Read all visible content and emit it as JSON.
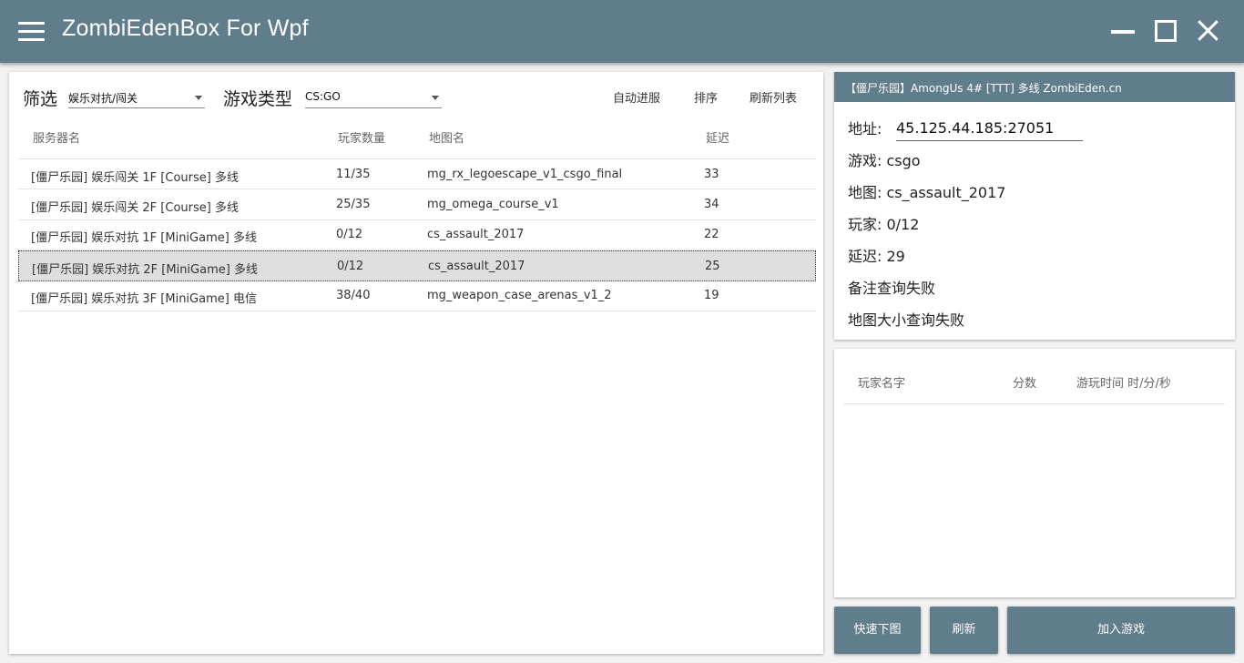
{
  "app": {
    "title": "ZombiEdenBox For Wpf"
  },
  "filter": {
    "label": "筛选",
    "value": "娱乐对抗/闯关",
    "game_type_label": "游戏类型",
    "game_type_value": "CS:GO"
  },
  "toolbar": {
    "auto_join_label": "自动进服",
    "sort_label": "排序",
    "refresh_list_label": "刷新列表"
  },
  "server_table": {
    "columns": [
      "服务器名",
      "玩家数量",
      "地图名",
      "延迟"
    ],
    "rows": [
      {
        "name": "[僵尸乐园] 娱乐闯关 1F [Course] 多线",
        "players": "11/35",
        "map": "mg_rx_legoescape_v1_csgo_final",
        "ping": "33"
      },
      {
        "name": "[僵尸乐园] 娱乐闯关 2F [Course] 多线",
        "players": "25/35",
        "map": "mg_omega_course_v1",
        "ping": "34"
      },
      {
        "name": "[僵尸乐园] 娱乐对抗 1F [MiniGame] 多线",
        "players": "0/12",
        "map": "cs_assault_2017",
        "ping": "22"
      },
      {
        "name": "[僵尸乐园] 娱乐对抗 2F [MiniGame] 多线",
        "players": "0/12",
        "map": "cs_assault_2017",
        "ping": "25"
      },
      {
        "name": "[僵尸乐园] 娱乐对抗 3F [MiniGame] 电信",
        "players": "38/40",
        "map": "mg_weapon_case_arenas_v1_2",
        "ping": "19"
      }
    ],
    "selected_index": 3
  },
  "server_info": {
    "header": "【僵尸乐园】AmongUs 4# [TTT] 多线 ZombiEden.cn",
    "address_label": "地址:",
    "address_value": "45.125.44.185:27051",
    "game": "游戏: csgo",
    "map": "地图: cs_assault_2017",
    "players": "玩家: 0/12",
    "ping": "延迟: 29",
    "note": "备注查询失败",
    "map_size": "地图大小查询失败"
  },
  "players_table": {
    "columns": [
      "玩家名字",
      "分数",
      "游玩时间 时/分/秒"
    ]
  },
  "actions": {
    "quick_download": "快速下图",
    "refresh": "刷新",
    "join_game": "加入游戏"
  },
  "colors": {
    "accent": "#607d8b",
    "selected_row": "#dedede"
  }
}
